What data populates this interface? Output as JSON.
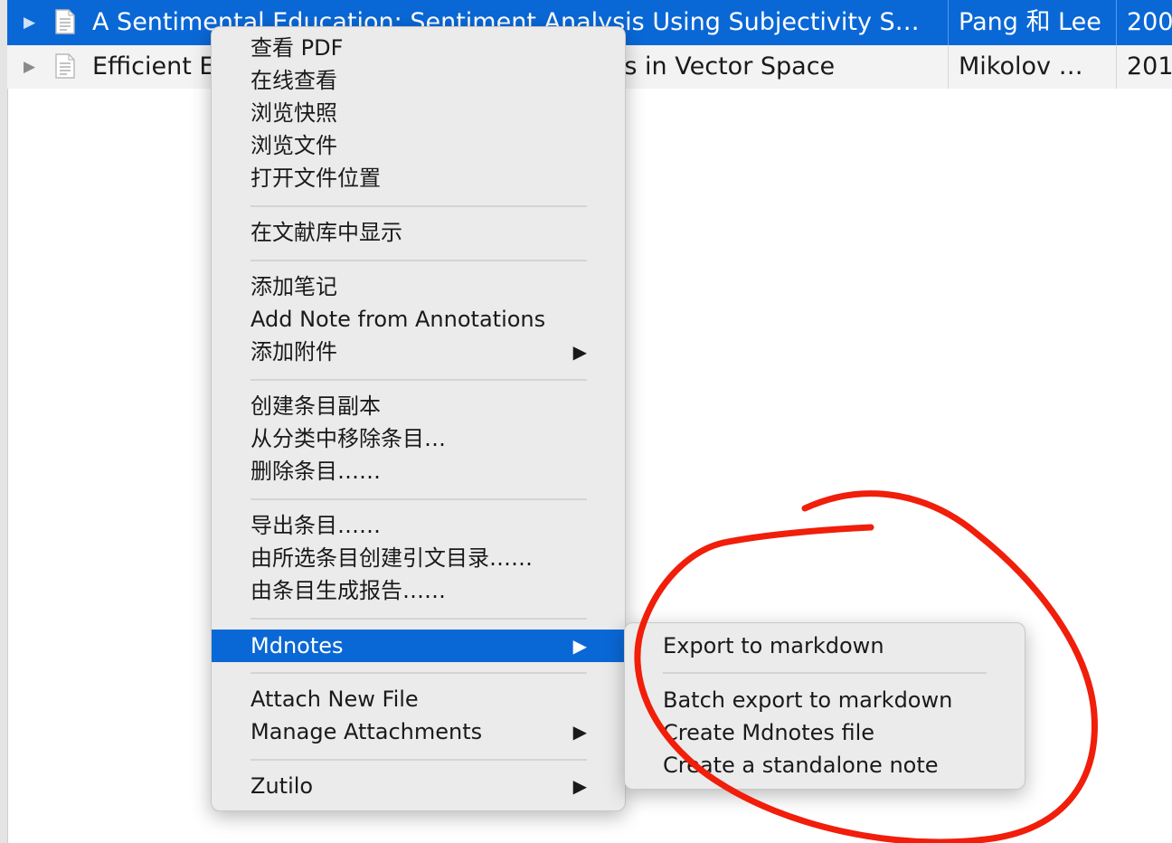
{
  "list": {
    "rows": [
      {
        "title": "A Sentimental Education: Sentiment Analysis Using Subjectivity S…",
        "author": "Pang 和 Lee",
        "year": "200"
      },
      {
        "title": "Efficient Estimation of Word Representations in Vector Space",
        "author": "Mikolov …",
        "year": "201"
      }
    ]
  },
  "context_menu": {
    "view_pdf": "查看 PDF",
    "view_online": "在线查看",
    "view_snapshot": "浏览快照",
    "view_file": "浏览文件",
    "open_location": "打开文件位置",
    "show_in_library": "在文献库中显示",
    "add_note": "添加笔记",
    "add_note_annotations": "Add Note from Annotations",
    "add_attachment": "添加附件",
    "duplicate_item": "创建条目副本",
    "remove_from_collection": "从分类中移除条目…",
    "delete_item": "删除条目……",
    "export_item": "导出条目……",
    "create_bibliography": "由所选条目创建引文目录……",
    "generate_report": "由条目生成报告……",
    "mdnotes": "Mdnotes",
    "attach_new_file": "Attach New File",
    "manage_attachments": "Manage Attachments",
    "zutilo": "Zutilo"
  },
  "mdnotes_submenu": {
    "export_markdown": "Export to markdown",
    "batch_export": "Batch export to markdown",
    "create_mdnotes_file": "Create Mdnotes file",
    "standalone_note": "Create a standalone note"
  },
  "colors": {
    "selection": "#0a68d6",
    "annotation": "#f01e0a",
    "menu_bg": "#ebebeb"
  }
}
